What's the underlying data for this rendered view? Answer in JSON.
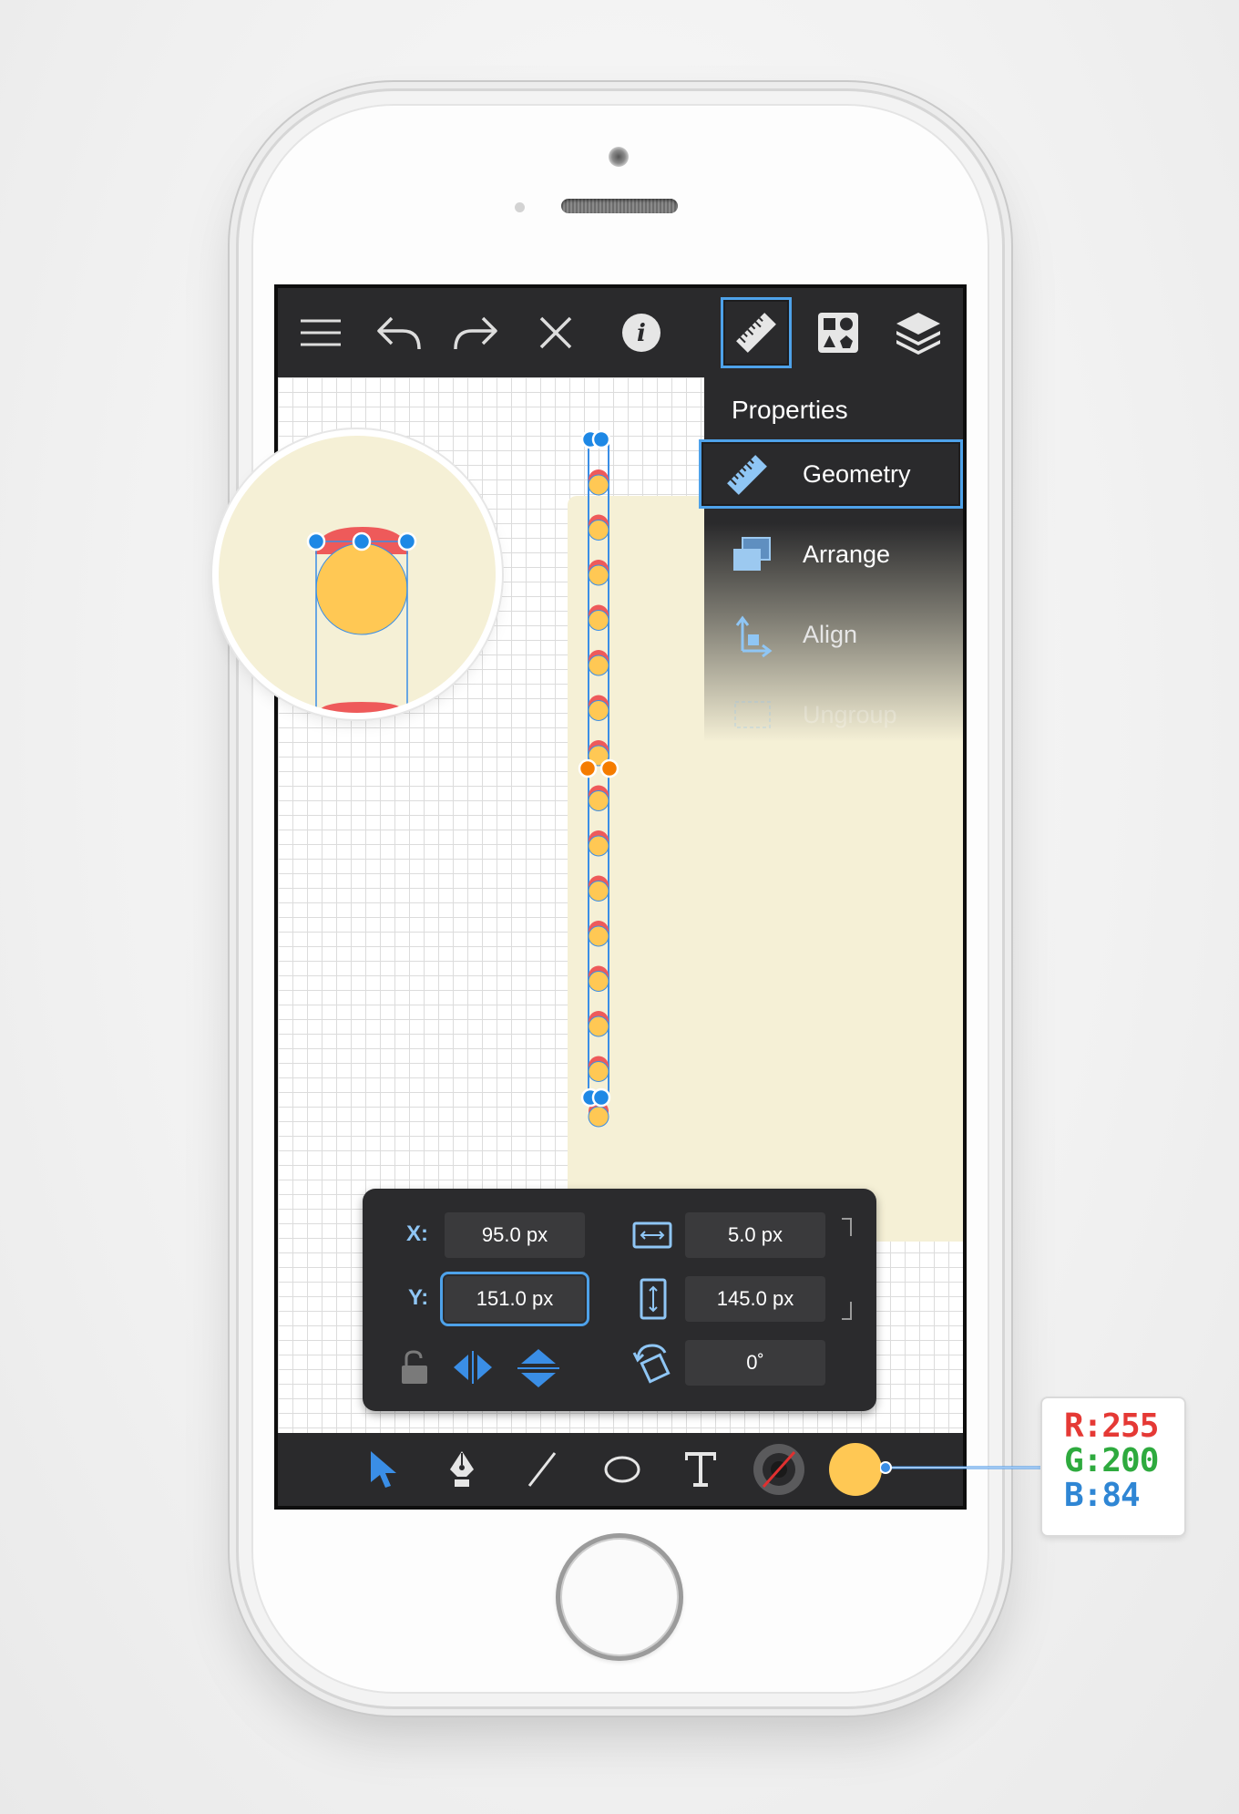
{
  "toolbar": {
    "items": [
      {
        "name": "menu-icon"
      },
      {
        "name": "undo-icon"
      },
      {
        "name": "redo-icon"
      },
      {
        "name": "close-icon"
      },
      {
        "name": "info-icon"
      },
      {
        "name": "ruler-icon",
        "active": true
      },
      {
        "name": "shapes-icon"
      },
      {
        "name": "layers-icon"
      }
    ]
  },
  "properties": {
    "title": "Properties",
    "items": [
      {
        "label": "Geometry",
        "icon": "ruler-icon",
        "active": true
      },
      {
        "label": "Arrange",
        "icon": "arrange-icon"
      },
      {
        "label": "Align",
        "icon": "align-icon"
      },
      {
        "label": "Ungroup",
        "icon": "ungroup-icon"
      }
    ]
  },
  "geometry": {
    "x_label": "X:",
    "x_value": "95.0 px",
    "y_label": "Y:",
    "y_value": "151.0 px",
    "width_value": "5.0 px",
    "height_value": "145.0 px",
    "rotation_value": "0˚"
  },
  "tools": [
    {
      "name": "select-tool-icon",
      "active": true
    },
    {
      "name": "pen-tool-icon"
    },
    {
      "name": "line-tool-icon"
    },
    {
      "name": "ellipse-tool-icon"
    },
    {
      "name": "text-tool-icon"
    },
    {
      "name": "stroke-color-icon"
    },
    {
      "name": "fill-color-swatch"
    }
  ],
  "fill_color": {
    "r_label": "R:",
    "r_value": "255",
    "g_label": "G:",
    "g_value": "200",
    "b_label": "B:",
    "b_value": "84",
    "hex": "#FFC854"
  },
  "colors": {
    "accent": "#4EA2EA",
    "toolbar_bg": "#2A2A2C",
    "artboard": "#F5F0D6",
    "red": "#EE5A5A",
    "yellow": "#FFC854",
    "orange": "#F57C00"
  }
}
